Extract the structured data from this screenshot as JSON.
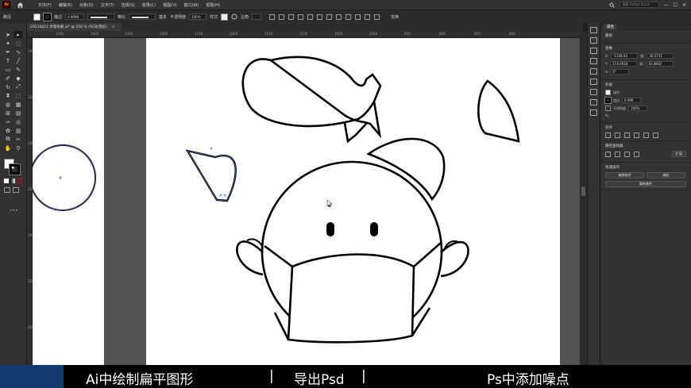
{
  "menubar": {
    "app_icon": "Ai",
    "items": [
      "文件(F)",
      "编辑(E)",
      "对象(O)",
      "文字(T)",
      "选择(S)",
      "效果(C)",
      "视图(V)",
      "窗口(W)",
      "帮助(H)"
    ],
    "search_placeholder": "搜索 Adobe Stock"
  },
  "controlbar": {
    "path_label": "路径",
    "stroke_label": "描边",
    "stroke_weight": "0.9998",
    "profile_label": "等比",
    "brush_label": "基本",
    "opacity_label": "不透明度",
    "opacity_value": "100%",
    "style_label": "样式",
    "corner_label": "边角",
    "transform_label": "变换"
  },
  "document_tab": {
    "title": "20210611 步骤拆解.ai* @ 150 % (RGB/预览)",
    "close": "×"
  },
  "rulers": {
    "top": [
      "1450",
      "1400",
      "1350",
      "1300",
      "1250",
      "1200",
      "1150",
      "1100",
      "1050",
      "1000",
      "950",
      "900",
      "850",
      "800"
    ],
    "left": [
      "100",
      "150",
      "200",
      "250",
      "300",
      "350",
      "400"
    ]
  },
  "panel": {
    "tab": "属性",
    "path_title": "路径",
    "transform_title": "变换",
    "x_label": "X:",
    "x_value": "-1338.43",
    "w_label": "宽:",
    "w_value": "30.5731",
    "y_label": "Y:",
    "y_value": "174.0618",
    "h_label": "高:",
    "h_value": "61.8692",
    "angle_value": "0°",
    "appearance_title": "外观",
    "fill_label": "填色",
    "stroke_label": "描边",
    "stroke_value": "0.999",
    "opacity_label": "不透明度",
    "opacity_value": "100%",
    "fx_label": "fx.",
    "align_title": "对齐",
    "pathfinder_title": "路径查找器",
    "pathfinder_expand": "扩展",
    "quick_actions_title": "快速操作",
    "offset_path_btn": "偏移路径",
    "edit_btn": "编组",
    "recolor_btn": "重新着色"
  },
  "caption": {
    "item1": "Ai中绘制扁平图形",
    "sep1": "|",
    "item2": "导出Psd",
    "sep2": "|",
    "item3": "Ps中添加噪点"
  },
  "colors": {
    "menubar": "#323232",
    "canvas": "#535353",
    "artboard": "#ffffff",
    "caption_bg": "#000000",
    "caption_accent": "#0f3b6e",
    "selection": "#4a5fa8"
  }
}
